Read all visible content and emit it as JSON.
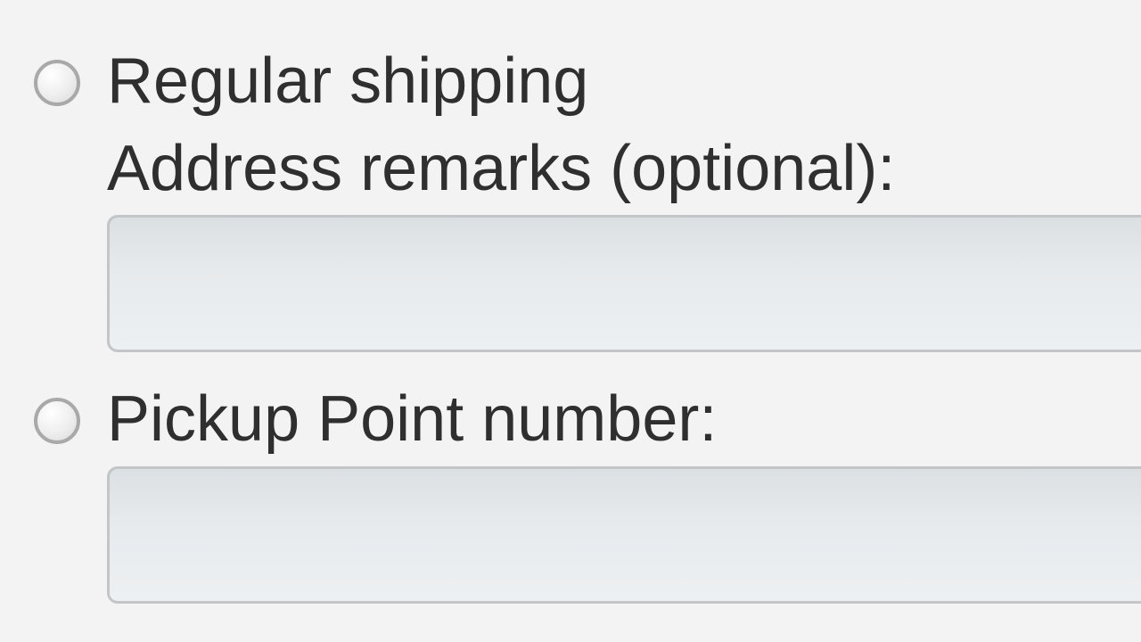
{
  "shipping": {
    "options": {
      "regular": {
        "label": "Regular shipping",
        "sub_label": "Address remarks (optional):",
        "remarks_value": ""
      },
      "pickup": {
        "label": "Pickup Point number:",
        "value": ""
      }
    }
  }
}
